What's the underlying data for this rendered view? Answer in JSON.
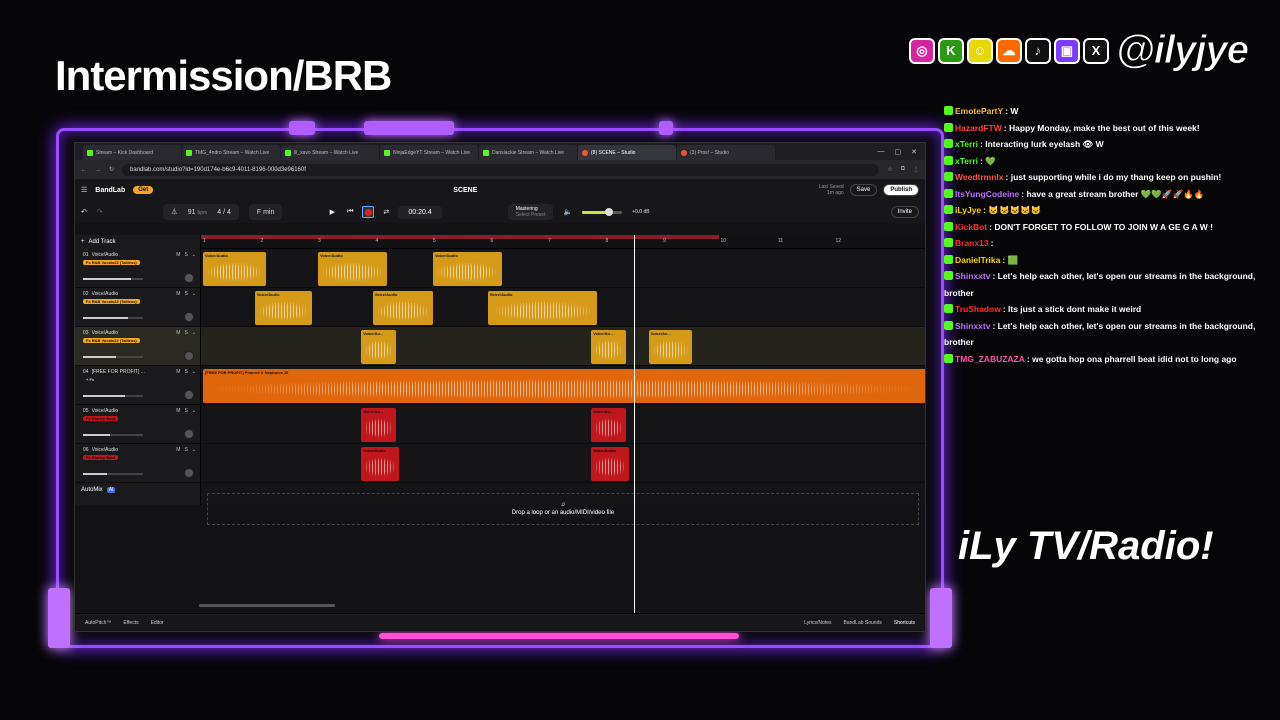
{
  "overlay": {
    "title": "Intermission/BRB",
    "handle": "@ilyjye",
    "side_title": "iLy TV/Radio!",
    "socials": [
      {
        "icon": "instagram-icon",
        "glyph": "◎",
        "color": "#d6249f"
      },
      {
        "icon": "kick-icon",
        "glyph": "K",
        "color": "#2a9a12"
      },
      {
        "icon": "snapchat-icon",
        "glyph": "☺",
        "color": "#e6d800"
      },
      {
        "icon": "soundcloud-icon",
        "glyph": "☁",
        "color": "#ff6a00"
      },
      {
        "icon": "tiktok-icon",
        "glyph": "♪",
        "color": "#111111"
      },
      {
        "icon": "twitch-icon",
        "glyph": "▣",
        "color": "#7a3cff"
      },
      {
        "icon": "x-icon",
        "glyph": "X",
        "color": "#111111"
      }
    ]
  },
  "browser": {
    "tabs": [
      {
        "label": "Stream – Kick Dashboard",
        "kind": "kick"
      },
      {
        "label": "TMG_4ndro Stream – Watch Live",
        "kind": "kick"
      },
      {
        "label": "lil_xavo Stream – Watch Live",
        "kind": "kick"
      },
      {
        "label": "NinjaEdgeYT Stream – Watch Live",
        "kind": "kick"
      },
      {
        "label": "Danslackie Stream – Watch Live",
        "kind": "kick"
      },
      {
        "label": "(8) SCENE – Studio",
        "kind": "red",
        "active": true
      },
      {
        "label": "(3) Pros! – Studio",
        "kind": "red"
      }
    ],
    "url": "bandlab.com/studio?id=190d174e-b6c9-4011-8196-000d3e96160f",
    "gemini_label": "Gemini"
  },
  "bandlab": {
    "logo": "BandLab",
    "get_label": "Get",
    "project_name": "SCENE",
    "last_saved": "Last Saved",
    "last_saved_ago": "1m ago",
    "save_label": "Save",
    "publish_label": "Publish",
    "bpm": "91",
    "bpm_unit": "bpm",
    "time_sig": "4 / 4",
    "key": "F min",
    "time": "00:20.4",
    "mastering_label": "Mastering",
    "mastering_preset": "Select Preset",
    "master_db": "+0.0 dB",
    "invite_label": "Invite",
    "add_track_label": "Add Track",
    "automix_label": "AutoMix",
    "automix_badge": "AI",
    "drop_hint": "Drop a loop or an audio/MIDI/video file",
    "ruler": [
      "1",
      "2",
      "3",
      "4",
      "5",
      "6",
      "7",
      "8",
      "9",
      "10",
      "11",
      "12"
    ],
    "tracks": [
      {
        "num": "01",
        "name": "Voice/Audio",
        "fx": "Fx R&B Vocals22 (Tailless)",
        "fx_color": "#f5a623",
        "vol": 0.8
      },
      {
        "num": "02",
        "name": "Voice/Audio",
        "fx": "Fx R&B Vocals22 (Tailless)",
        "fx_color": "#f5a623",
        "vol": 0.75
      },
      {
        "num": "03",
        "name": "Voice/Audio",
        "fx": "Fx R&B Vocals22 (Tailless)",
        "fx_color": "#f5a623",
        "vol": 0.55
      },
      {
        "num": "04",
        "name": "[FREE FOR PROFIT] ...",
        "fx": "+ Fx",
        "fx_color": "",
        "vol": 0.7
      },
      {
        "num": "05",
        "name": "Voice/Audio",
        "fx": "Fx Stoney Bout",
        "fx_color": "#c0161c",
        "vol": 0.45
      },
      {
        "num": "06",
        "name": "Voice/Audio",
        "fx": "Fx Stoney Bout",
        "fx_color": "#c0161c",
        "vol": 0.4
      }
    ],
    "clips": [
      {
        "lane": 0,
        "color": "y",
        "label": "Voice/Audio",
        "start": 0,
        "len": 1.1
      },
      {
        "lane": 0,
        "color": "y",
        "label": "Voice/Audio",
        "start": 2,
        "len": 1.2
      },
      {
        "lane": 0,
        "color": "y",
        "label": "Voice/Audio",
        "start": 4,
        "len": 1.2
      },
      {
        "lane": 1,
        "color": "y",
        "label": "Voice/Audio",
        "start": 0.9,
        "len": 1
      },
      {
        "lane": 1,
        "color": "y",
        "label": "Voice/Audio",
        "start": 2.95,
        "len": 1.05
      },
      {
        "lane": 1,
        "color": "y",
        "label": "Voice/Audio",
        "start": 4.95,
        "len": 1.9
      },
      {
        "lane": 2,
        "color": "y",
        "label": "Voice/Au...",
        "start": 2.75,
        "len": 0.6
      },
      {
        "lane": 2,
        "color": "y",
        "label": "Voice/Au...",
        "start": 6.75,
        "len": 0.6
      },
      {
        "lane": 2,
        "color": "y",
        "label": "Voice/Au...",
        "start": 7.75,
        "len": 0.75
      },
      {
        "lane": 3,
        "color": "o",
        "label": "[FREE FOR PROFIT] Pharrell X Neptunes 10",
        "start": 0,
        "len": 12.6
      },
      {
        "lane": 4,
        "color": "r",
        "label": "Voice/Au...",
        "start": 2.75,
        "len": 0.6
      },
      {
        "lane": 4,
        "color": "r",
        "label": "Voice/Au...",
        "start": 6.75,
        "len": 0.6
      },
      {
        "lane": 5,
        "color": "r",
        "label": "Voice/Audio",
        "start": 2.75,
        "len": 0.65
      },
      {
        "lane": 5,
        "color": "r",
        "label": "Voice/Audio",
        "start": 6.75,
        "len": 0.65
      }
    ],
    "playhead_bar": 8.5,
    "status_left": [
      "AutoPitch™",
      "Effects",
      "Editor"
    ],
    "status_right": [
      "Lyrics/Notes",
      "BandLab Sounds",
      "Shortcuts"
    ]
  },
  "chat": [
    {
      "user": "EmotePartY",
      "color": "#f5b942",
      "text": "W"
    },
    {
      "user": "HazardFTW",
      "color": "#ff4040",
      "text": "Happy Monday, make the best out of this week!"
    },
    {
      "user": "xTerri",
      "color": "#53fc18",
      "text": "Interacting lurk eyelash 👁 W"
    },
    {
      "user": "xTerri",
      "color": "#53fc18",
      "text": "💚"
    },
    {
      "user": "Weedtrmnlx",
      "color": "#ff5050",
      "text": "just supporting while i do my thang keep on pushin!"
    },
    {
      "user": "ItsYungCodeine",
      "color": "#c070ff",
      "text": "have a great stream brother 💚💚🚀🚀🔥🔥"
    },
    {
      "user": "iLyJye",
      "color": "#ffd400",
      "text": "🐱🐱🐱🐱🐱"
    },
    {
      "user": "KickBot",
      "color": "#ff3030",
      "text": "DON'T FORGET TO FOLLOW TO JOIN W A GE G A W !"
    },
    {
      "user": "Branx13",
      "color": "#ff3030",
      "text": ""
    },
    {
      "user": "DanielTrika",
      "color": "#ffd400",
      "text": "🟩"
    },
    {
      "user": "Shinxxtv",
      "color": "#c070ff",
      "text": "Let's help each other, let's open our streams in the background, brother"
    },
    {
      "user": "TruShadow",
      "color": "#ff3030",
      "text": "Its just a stick dont make it weird"
    },
    {
      "user": "Shinxxtv",
      "color": "#c070ff",
      "text": "Let's help each other, let's open our streams in the background, brother"
    },
    {
      "user": "TMG_ZABUZAZA",
      "color": "#ff5aa0",
      "text": "we gotta hop ona pharrell beat idid not to long ago"
    }
  ]
}
